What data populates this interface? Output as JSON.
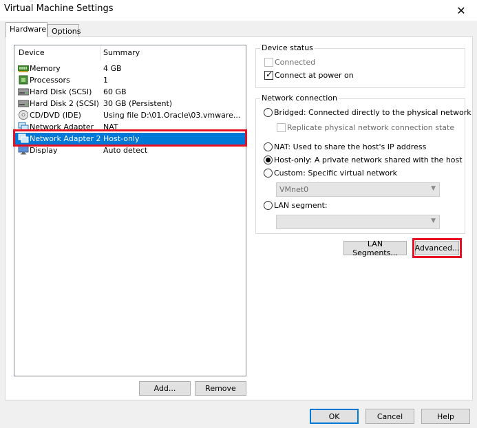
{
  "window": {
    "title": "Virtual Machine Settings"
  },
  "tabs": [
    "Hardware",
    "Options"
  ],
  "device_list": {
    "headers": {
      "device": "Device",
      "summary": "Summary"
    },
    "rows": [
      {
        "device": "Memory",
        "summary": "4 GB",
        "icon": "memory-icon"
      },
      {
        "device": "Processors",
        "summary": "1",
        "icon": "processor-icon"
      },
      {
        "device": "Hard Disk (SCSI)",
        "summary": "60 GB",
        "icon": "hard-disk-icon"
      },
      {
        "device": "Hard Disk 2 (SCSI)",
        "summary": "30 GB (Persistent)",
        "icon": "hard-disk-icon"
      },
      {
        "device": "CD/DVD (IDE)",
        "summary": "Using file D:\\01.Oracle\\03.vmware...",
        "icon": "cd-dvd-icon"
      },
      {
        "device": "Network Adapter",
        "summary": "NAT",
        "icon": "network-adapter-icon"
      },
      {
        "device": "Network Adapter 2",
        "summary": "Host-only",
        "icon": "network-adapter-icon",
        "selected": true
      },
      {
        "device": "Display",
        "summary": "Auto detect",
        "icon": "display-icon"
      }
    ]
  },
  "list_buttons": {
    "add": "Add...",
    "remove": "Remove"
  },
  "device_status": {
    "label": "Device status",
    "connected": {
      "label": "Connected",
      "checked": false,
      "enabled": false
    },
    "connect_at_power_on": {
      "label": "Connect at power on",
      "checked": true,
      "enabled": true
    }
  },
  "network_connection": {
    "label": "Network connection",
    "bridged": "Bridged: Connected directly to the physical network",
    "replicate": "Replicate physical network connection state",
    "nat": "NAT: Used to share the host's IP address",
    "host_only": "Host-only: A private network shared with the host",
    "custom": "Custom: Specific virtual network",
    "custom_value": "VMnet0",
    "lan_segment": "LAN segment:",
    "lan_segment_value": "",
    "selected": "host_only"
  },
  "net_buttons": {
    "lan_segments": "LAN Segments...",
    "advanced": "Advanced..."
  },
  "footer": {
    "ok": "OK",
    "cancel": "Cancel",
    "help": "Help"
  },
  "colors": {
    "selection": "#0078d7",
    "highlight_border": "#e81123"
  }
}
